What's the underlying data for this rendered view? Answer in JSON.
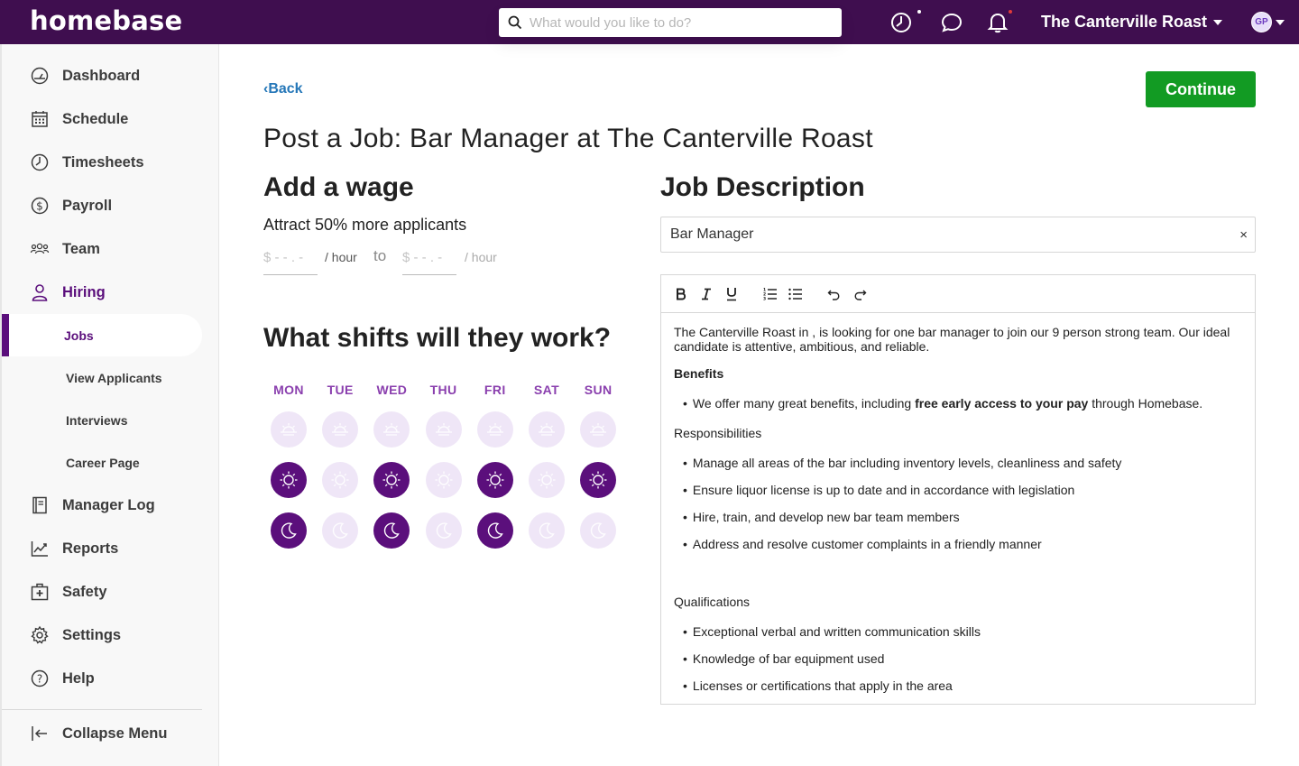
{
  "header": {
    "logo": "homebase",
    "search_placeholder": "What would you like to do?",
    "location": "The Canterville Roast",
    "avatar_initials": "GP"
  },
  "sidebar": {
    "items": [
      {
        "label": "Dashboard",
        "icon": "dashboard-icon"
      },
      {
        "label": "Schedule",
        "icon": "calendar-icon"
      },
      {
        "label": "Timesheets",
        "icon": "clock-icon"
      },
      {
        "label": "Payroll",
        "icon": "dollar-icon"
      },
      {
        "label": "Team",
        "icon": "team-icon"
      },
      {
        "label": "Hiring",
        "icon": "person-icon"
      }
    ],
    "hiring_sub": [
      {
        "label": "Jobs"
      },
      {
        "label": "View Applicants"
      },
      {
        "label": "Interviews"
      },
      {
        "label": "Career Page"
      }
    ],
    "lower_items": [
      {
        "label": "Manager Log",
        "icon": "log-icon"
      },
      {
        "label": "Reports",
        "icon": "reports-icon"
      },
      {
        "label": "Safety",
        "icon": "first-aid-icon"
      },
      {
        "label": "Settings",
        "icon": "gear-icon"
      },
      {
        "label": "Help",
        "icon": "help-icon"
      }
    ],
    "collapse": "Collapse Menu"
  },
  "main": {
    "back": "Back",
    "continue": "Continue",
    "title": "Post a Job: Bar Manager at The Canterville Roast",
    "wage": {
      "heading": "Add a wage",
      "subtitle": "Attract 50% more applicants",
      "min_placeholder": "$ - - . -",
      "max_placeholder": "$ - - . -",
      "unit": "/ hour",
      "to": "to"
    },
    "shifts": {
      "heading": "What shifts will they work?",
      "days": [
        "MON",
        "TUE",
        "WED",
        "THU",
        "FRI",
        "SAT",
        "SUN"
      ],
      "morning": [
        false,
        false,
        false,
        false,
        false,
        false,
        false
      ],
      "day": [
        true,
        false,
        true,
        false,
        true,
        false,
        true
      ],
      "night": [
        true,
        false,
        true,
        false,
        true,
        false,
        false
      ]
    },
    "job_description": {
      "heading": "Job Description",
      "job_title_value": "Bar Manager",
      "clear": "×",
      "intro": "The Canterville Roast in , is looking for one bar manager to join our 9 person strong team. Our ideal candidate is attentive, ambitious, and reliable.",
      "benefits_heading": "Benefits",
      "benefit_pre": "We offer many great benefits, including ",
      "benefit_bold": "free early access to your pay",
      "benefit_post": " through Homebase.",
      "responsibilities_heading": "Responsibilities",
      "responsibilities": [
        "Manage all areas of the bar including inventory levels, cleanliness and safety",
        "Ensure liquor license is up to date and in accordance with legislation",
        "Hire, train, and develop new bar team members",
        "Address and resolve customer complaints in a friendly manner"
      ],
      "qualifications_heading": "Qualifications",
      "qualifications": [
        "Exceptional verbal and written communication skills",
        "Knowledge of bar equipment used",
        "Licenses or certifications that apply in the area"
      ]
    }
  },
  "colors": {
    "brand": "#3f0e4f",
    "accent": "#5b0f7c",
    "shift_off": "#efe6f7",
    "continue": "#129b23",
    "link": "#2577b8"
  }
}
